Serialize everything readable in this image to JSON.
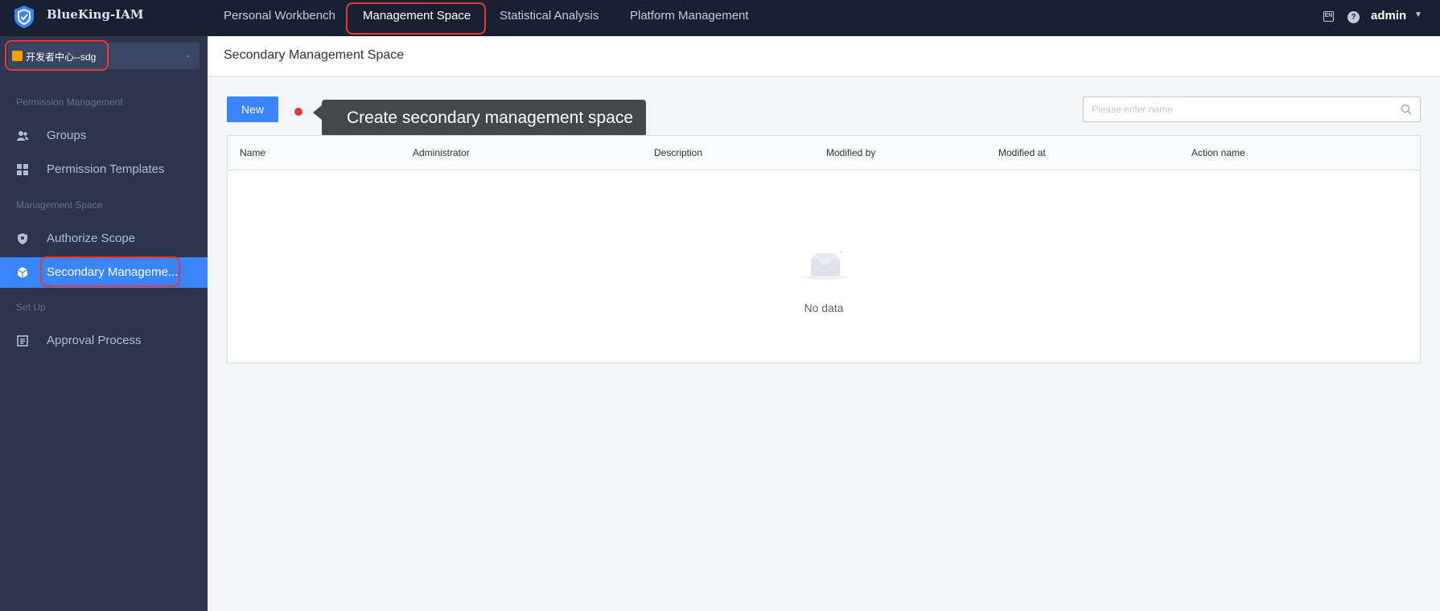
{
  "app": {
    "brand": "BlueKing-IAM"
  },
  "topnav": {
    "items": [
      {
        "label": "Personal Workbench",
        "active": false
      },
      {
        "label": "Management Space",
        "active": true
      },
      {
        "label": "Statistical Analysis",
        "active": false
      },
      {
        "label": "Platform Management",
        "active": false
      }
    ],
    "lang_icon": "language-icon",
    "help_icon": "help-icon",
    "user": "admin"
  },
  "sidebar": {
    "space_select": {
      "value": "开发者中心--sdg"
    },
    "groups": [
      {
        "title": "Permission Management"
      },
      {
        "title": "Management Space"
      },
      {
        "title": "Set Up"
      }
    ],
    "items": [
      {
        "label": "Groups",
        "icon": "users-icon"
      },
      {
        "label": "Permission Templates",
        "icon": "grid-icon"
      },
      {
        "label": "Authorize Scope",
        "icon": "shield-icon"
      },
      {
        "label": "Secondary Manageme...",
        "icon": "cube-icon",
        "active": true
      },
      {
        "label": "Approval Process",
        "icon": "document-icon"
      }
    ]
  },
  "main": {
    "page_title": "Secondary Management Space",
    "new_button": "New",
    "tooltip": "Create secondary management space",
    "search": {
      "placeholder": "Please enter name",
      "value": ""
    },
    "table": {
      "columns": [
        "Name",
        "Administrator",
        "Description",
        "Modified by",
        "Modified at",
        "Action name"
      ],
      "rows": [],
      "empty_text": "No data"
    }
  },
  "colors": {
    "topbar": "#182132",
    "sidebar": "#2c354d",
    "accent": "#3a84ff",
    "highlight": "#e53935",
    "tooltip_bg": "#46474a"
  }
}
